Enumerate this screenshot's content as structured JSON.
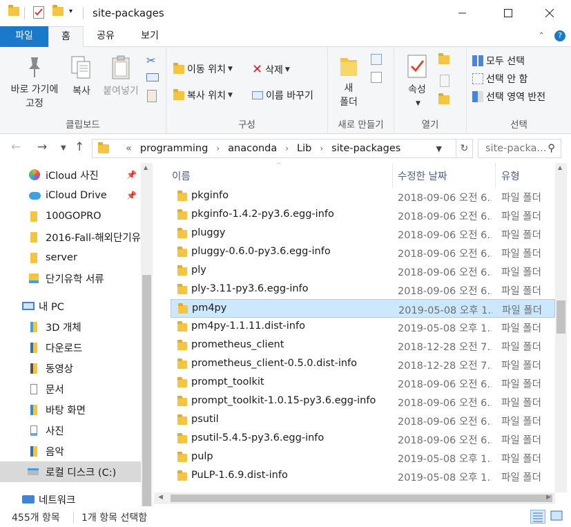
{
  "window": {
    "title": "site-packages",
    "minimize": "—",
    "maximize": "☐",
    "close": "✕"
  },
  "tabs": [
    {
      "label": "파일"
    },
    {
      "label": "홈"
    },
    {
      "label": "공유"
    },
    {
      "label": "보기"
    }
  ],
  "ribbon": {
    "clipboard": {
      "label": "클립보드",
      "pin_label_1": "바로 가기에",
      "pin_label_2": "고정",
      "copy": "복사",
      "paste": "붙여넣기"
    },
    "organize": {
      "label": "구성",
      "move_to": "이동 위치",
      "copy_to": "복사 위치",
      "delete": "삭제",
      "rename": "이름 바꾸기"
    },
    "new": {
      "label": "새로 만들기",
      "new_folder_1": "새",
      "new_folder_2": "폴더"
    },
    "open": {
      "label": "열기",
      "properties": "속성"
    },
    "select": {
      "label": "선택",
      "select_all": "모두 선택",
      "select_none": "선택 안 함",
      "invert": "선택 영역 반전"
    }
  },
  "address": {
    "overflow": "«",
    "crumbs": [
      "programming",
      "anaconda",
      "Lib",
      "site-packages"
    ],
    "search_placeholder": "site-packa..."
  },
  "nav": {
    "items": [
      {
        "label": "iCloud 사진",
        "icon": "icloud-photos-icon"
      },
      {
        "label": "iCloud Drive",
        "icon": "icloud-drive-icon"
      },
      {
        "label": "100GOPRO",
        "icon": "folder-icon"
      },
      {
        "label": "2016-Fall-해외단기유",
        "icon": "folder-icon"
      },
      {
        "label": "server",
        "icon": "folder-icon"
      },
      {
        "label": "단기유학 서류",
        "icon": "folder-icon"
      },
      {
        "label": "내 PC",
        "icon": "pc-icon"
      },
      {
        "label": "3D 개체",
        "icon": "3d-objects-icon"
      },
      {
        "label": "다운로드",
        "icon": "downloads-icon"
      },
      {
        "label": "동영상",
        "icon": "videos-icon"
      },
      {
        "label": "문서",
        "icon": "documents-icon"
      },
      {
        "label": "바탕 화면",
        "icon": "desktop-icon"
      },
      {
        "label": "사진",
        "icon": "pictures-icon"
      },
      {
        "label": "음악",
        "icon": "music-icon"
      },
      {
        "label": "로컬 디스크 (C:)",
        "icon": "drive-icon"
      },
      {
        "label": "네트워크",
        "icon": "network-icon"
      }
    ]
  },
  "columns": {
    "name": "이름",
    "date": "수정한 날짜",
    "type": "유형"
  },
  "files": [
    {
      "name": "pkginfo",
      "date": "2018-09-06 오전 6...",
      "type": "파일 폴더"
    },
    {
      "name": "pkginfo-1.4.2-py3.6.egg-info",
      "date": "2018-09-06 오전 6...",
      "type": "파일 폴더"
    },
    {
      "name": "pluggy",
      "date": "2018-09-06 오전 6...",
      "type": "파일 폴더"
    },
    {
      "name": "pluggy-0.6.0-py3.6.egg-info",
      "date": "2018-09-06 오전 6...",
      "type": "파일 폴더"
    },
    {
      "name": "ply",
      "date": "2018-09-06 오전 6...",
      "type": "파일 폴더"
    },
    {
      "name": "ply-3.11-py3.6.egg-info",
      "date": "2018-09-06 오전 6...",
      "type": "파일 폴더"
    },
    {
      "name": "pm4py",
      "date": "2019-05-08 오후 1...",
      "type": "파일 폴더"
    },
    {
      "name": "pm4py-1.1.11.dist-info",
      "date": "2019-05-08 오후 1...",
      "type": "파일 폴더"
    },
    {
      "name": "prometheus_client",
      "date": "2018-12-28 오전 7...",
      "type": "파일 폴더"
    },
    {
      "name": "prometheus_client-0.5.0.dist-info",
      "date": "2018-12-28 오전 7...",
      "type": "파일 폴더"
    },
    {
      "name": "prompt_toolkit",
      "date": "2018-09-06 오전 6...",
      "type": "파일 폴더"
    },
    {
      "name": "prompt_toolkit-1.0.15-py3.6.egg-info",
      "date": "2018-09-06 오전 6...",
      "type": "파일 폴더"
    },
    {
      "name": "psutil",
      "date": "2018-09-06 오전 6...",
      "type": "파일 폴더"
    },
    {
      "name": "psutil-5.4.5-py3.6.egg-info",
      "date": "2018-09-06 오전 6...",
      "type": "파일 폴더"
    },
    {
      "name": "pulp",
      "date": "2019-05-08 오후 1...",
      "type": "파일 폴더"
    },
    {
      "name": "PuLP-1.6.9.dist-info",
      "date": "2019-05-08 오후 1...",
      "type": "파일 폴더"
    }
  ],
  "status": {
    "count": "455개 항목",
    "selected": "1개 항목 선택함"
  }
}
